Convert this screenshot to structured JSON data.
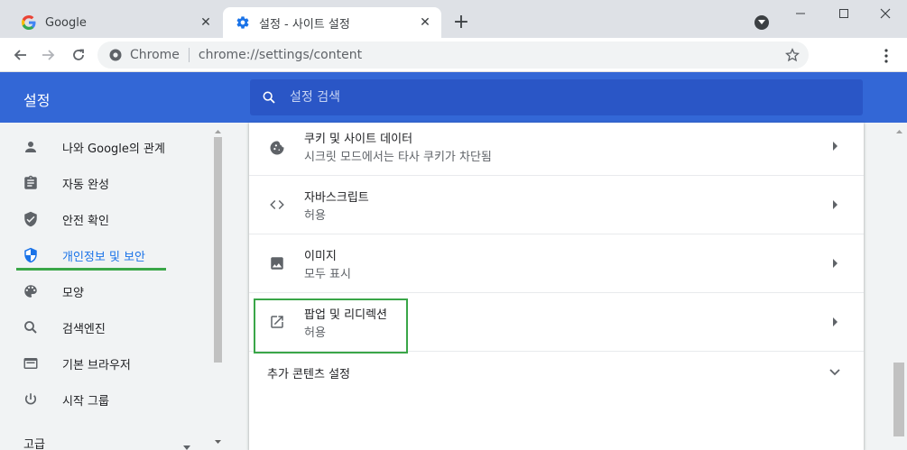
{
  "tabs": [
    {
      "title": "Google",
      "favicon": "google-g-icon",
      "active": false
    },
    {
      "title": "설정 - 사이트 설정",
      "favicon": "gear-icon",
      "active": true
    }
  ],
  "new_tab_symbol": "+",
  "toolbar": {
    "site_label": "Chrome",
    "url": "chrome://settings/content"
  },
  "settings": {
    "title": "설정",
    "search_placeholder": "설정 검색"
  },
  "sidebar": {
    "items": [
      {
        "label": "나와 Google의 관계",
        "icon": "person-icon"
      },
      {
        "label": "자동 완성",
        "icon": "clipboard-icon"
      },
      {
        "label": "안전 확인",
        "icon": "shield-check-icon"
      },
      {
        "label": "개인정보 및 보안",
        "icon": "shield-privacy-icon",
        "active": true
      },
      {
        "label": "모양",
        "icon": "palette-icon"
      },
      {
        "label": "검색엔진",
        "icon": "search-icon"
      },
      {
        "label": "기본 브라우저",
        "icon": "browser-window-icon"
      },
      {
        "label": "시작 그룹",
        "icon": "power-icon"
      }
    ],
    "advanced_label": "고급"
  },
  "content": {
    "rows": [
      {
        "title": "쿠키 및 사이트 데이터",
        "subtitle": "시크릿 모드에서는 타사 쿠키가 차단됨",
        "icon": "cookie-icon"
      },
      {
        "title": "자바스크립트",
        "subtitle": "허용",
        "icon": "code-icon"
      },
      {
        "title": "이미지",
        "subtitle": "모두 표시",
        "icon": "image-icon"
      },
      {
        "title": "팝업 및 리디렉션",
        "subtitle": "허용",
        "icon": "open-in-new-icon"
      }
    ],
    "more_label": "추가 콘텐츠 설정"
  },
  "colors": {
    "header_blue": "#3367d6",
    "search_blue": "#2a56c6",
    "active_blue": "#1a73e8",
    "highlight_green": "#3aa648"
  }
}
